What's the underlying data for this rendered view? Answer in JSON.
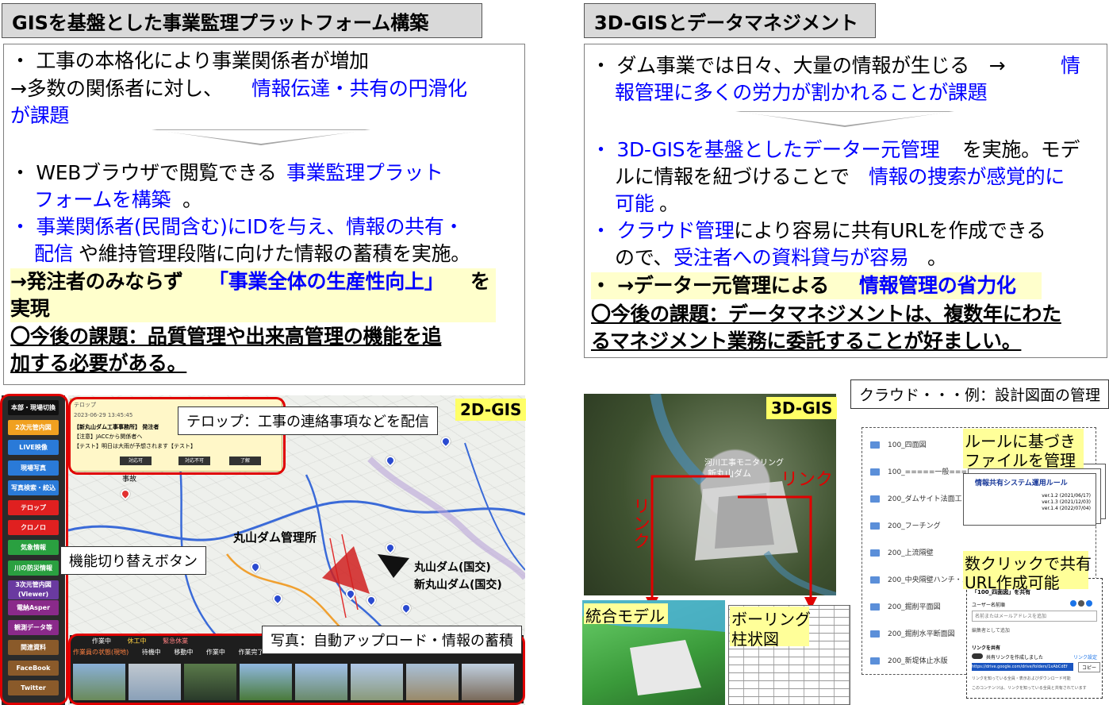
{
  "left": {
    "title": "GISを基盤とした事業監理プラットフォーム構築",
    "lines": [
      "・ 工事の本格化により事業関係者が増加",
      "→多数の関係者に対し、",
      "情報伝達・共有の円滑化",
      "が課題",
      "・ WEBブラウザで閲覧できる",
      "事業監理プラット",
      "フォームを構築",
      "。",
      "・ 事業関係者(民間含む)にIDを与え、情報の共有・",
      "配信",
      "や維持管理段階に向けた情報の蓄積を実施。",
      "→発注者のみならず",
      "「事業全体の生産性向上」",
      "を",
      "実現",
      "〇今後の課題：品質管理や出来高管理の機能を追",
      "加する必要がある。"
    ]
  },
  "right": {
    "title": "3D-GISとデータマネジメント",
    "lines": [
      "・ ダム事業では日々、大量の情報が生じる　→",
      "情",
      "報管理に多くの労力が割かれることが課題",
      "・ 3D-GISを基盤としたデーター元管理",
      "を実施。モデ",
      "ルに情報を紐づけることで",
      "情報の捜索が感覚的に",
      "可能",
      "。",
      "・ クラウド管理",
      "により容易に共有URLを作成できる",
      "ので、",
      "受注者への資料貸与が容易",
      "。",
      "・ →データー元管理による",
      "情報管理の省力化",
      "〇今後の課題：データマネジメントは、複数年にわた",
      "るマネジメント業務に委託することが好ましい。"
    ]
  },
  "gis2d": {
    "tag": "2D-GIS",
    "menu": [
      {
        "label": "本部・現場切換",
        "color": "#111111"
      },
      {
        "label": "2次元管内図",
        "color": "#f0a020"
      },
      {
        "label": "LIVE映像",
        "color": "#2a7ad8"
      },
      {
        "label": "現場写真",
        "color": "#2a7ad8"
      },
      {
        "label": "写真検索・絞込",
        "color": "#2a7ad8"
      },
      {
        "label": "テロップ",
        "color": "#e02020"
      },
      {
        "label": "クロノロ",
        "color": "#e02020"
      },
      {
        "label": "気象情報",
        "color": "#2aa040"
      },
      {
        "label": "川の防災情報",
        "color": "#2aa040"
      },
      {
        "label": "3次元管内図(Viewer)",
        "color": "#6a3aa0"
      },
      {
        "label": "電納Asper",
        "color": "#8a2a8a"
      },
      {
        "label": "観測データ等",
        "color": "#8a2a8a"
      },
      {
        "label": "関連資料",
        "color": "#8a5a2a"
      },
      {
        "label": "FaceBook",
        "color": "#8a5a2a"
      },
      {
        "label": "Twitter",
        "color": "#8a5a2a"
      }
    ],
    "telop": {
      "header": "テロップ",
      "date": "2023-06-29 13:45:45",
      "sender": "【新丸山ダム工事事務所】 発注者",
      "note1": "【注意】JACCから関係者へ",
      "note2": "【テスト】明日は大雨が予想されます【テスト】",
      "buttons": [
        "対応可",
        "対応不可",
        "了解"
      ]
    },
    "callout_telop": "テロップ：工事の連絡事項などを配信",
    "callout_switch": "機能切り替えボタン",
    "callout_photo": "写真：自動アップロード・情報の蓄積",
    "map_labels": [
      "丸山ダム管理所",
      "丸山ダム(国交)",
      "新丸山ダム(国交)",
      "事故"
    ],
    "legend": [
      "作業中",
      "休工中",
      "緊急休業",
      "待機中",
      "移動中",
      "作業中",
      "作業完了"
    ],
    "photo_bar_label": "作業員の状態(現地)"
  },
  "gis3d": {
    "tag": "3D-GIS",
    "labels": [
      "河川工事モニタリング",
      "新丸山ダム"
    ],
    "link1": "リンク",
    "link2": "リンク",
    "model_label": "統合モデル",
    "boring_label1": "ボーリング",
    "boring_label2": "柱状図"
  },
  "cloud": {
    "title": "クラウド・・・例：設計図面の管理",
    "rule_label1": "ルールに基づき",
    "rule_label2": "ファイルを管理",
    "doc_title": "情報共有システム運用ルール",
    "doc_versions": [
      "ver.1.2 (2021/06/17)",
      "ver.1.3 (2021/12/03)",
      "ver.1.4 (2022/07/04)"
    ],
    "share_label1": "数クリックで共有",
    "share_label2": "URL作成可能",
    "folders": [
      "100_四面図",
      "100_=====一般===",
      "200_ダムサイト法面工",
      "200_フーチング",
      "200_上流隔壁",
      "200_中央隔壁ハンチ・ス",
      "200_掘削平面図",
      "200_掘削水平断面図",
      "200_新堤体止水版"
    ],
    "share_dialog": {
      "title": "「100_四面図」を共有",
      "users_label": "ユーザー名前順",
      "input_placeholder": "名前またはメールアドレスを追加",
      "edit_label": "編集者として追加",
      "link_section": "リンクを共有",
      "toggle_label": "共有リンクを作成しました",
      "settings": "リンク設定",
      "url": "https://drive.google.com/drive/folders/1xAbCdEf",
      "copy": "コピー",
      "note": "リンクを知っている全員・表示およびダウンロード可能",
      "footer": "このコンテンツは、リンクを知っている全員と共有されています"
    }
  }
}
